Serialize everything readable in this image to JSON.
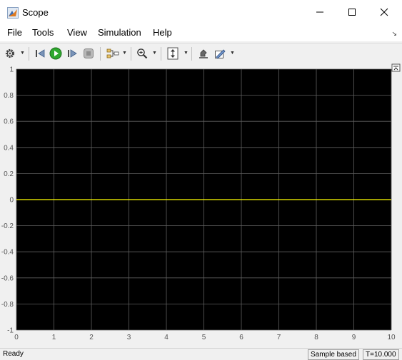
{
  "window": {
    "title": "Scope"
  },
  "menu": {
    "items": [
      "File",
      "Tools",
      "View",
      "Simulation",
      "Help"
    ]
  },
  "toolbar": {
    "buttons": [
      "settings-icon",
      "step-back-icon",
      "run-icon",
      "step-forward-icon",
      "stop-icon",
      "signal-select-icon",
      "zoom-in-icon",
      "autoscale-icon",
      "highlight-icon",
      "style-icon"
    ]
  },
  "colors": {
    "plot_bg": "#000000",
    "grid": "#5f5f5f",
    "trace": "#ffff00",
    "run_green": "#2ea82e"
  },
  "status": {
    "left": "Ready",
    "mode": "Sample based",
    "time": "T=10.000"
  },
  "chart_data": {
    "type": "line",
    "xlim": [
      0,
      10
    ],
    "ylim": [
      -1,
      1
    ],
    "xticks": [
      "0",
      "1",
      "2",
      "3",
      "4",
      "5",
      "6",
      "7",
      "8",
      "9",
      "10"
    ],
    "yticks": [
      "1",
      "0.8",
      "0.6",
      "0.4",
      "0.2",
      "0",
      "-0.2",
      "-0.4",
      "-0.6",
      "-0.8",
      "-1"
    ],
    "grid": true,
    "series": [
      {
        "x": [
          0,
          10
        ],
        "y": [
          0,
          0
        ],
        "color": "#ffff00"
      }
    ]
  }
}
